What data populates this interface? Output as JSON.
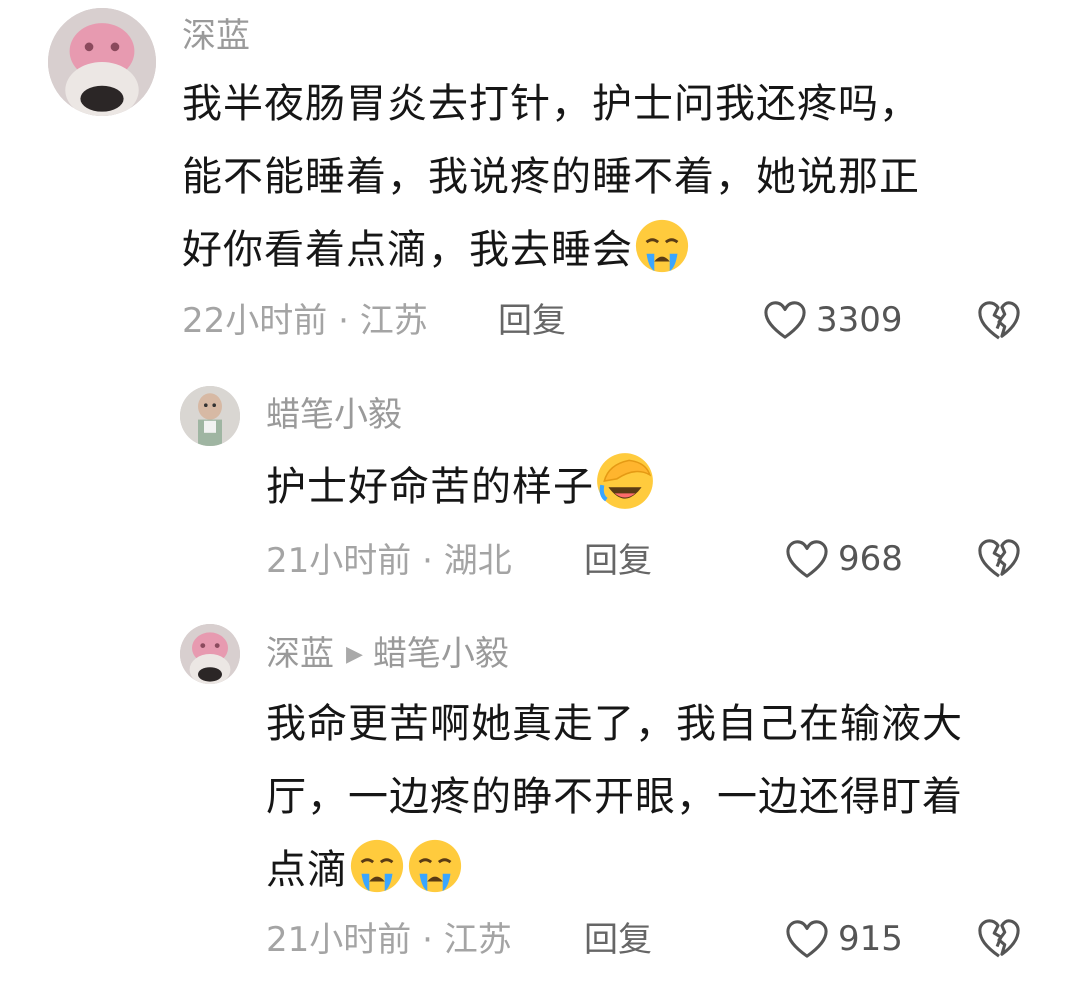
{
  "comments": [
    {
      "username": "深蓝",
      "text": "我半夜肠胃炎去打针，护士问我还疼吗，能不能睡着，我说疼的睡不着，她说那正好你看着点滴，我去睡会",
      "lines": [
        "我半夜肠胃炎去打针，护士问我还疼吗，",
        "能不能睡着，我说疼的睡不着，她说那正",
        "好你看着点滴，我去睡会"
      ],
      "emojis": [
        "crying-face"
      ],
      "time": "22小时前",
      "location": "江苏",
      "reply_label": "回复",
      "likes": "3309"
    },
    {
      "username": "蜡笔小毅",
      "text": "护士好命苦的样子",
      "lines": [
        "护士好命苦的样子"
      ],
      "emojis": [
        "facepalm-laughing-face"
      ],
      "time": "21小时前",
      "location": "湖北",
      "reply_label": "回复",
      "likes": "968"
    },
    {
      "username": "深蓝",
      "reply_to": "蜡笔小毅",
      "text": "我命更苦啊她真走了，我自己在输液大厅，一边疼的睁不开眼，一边还得盯着点滴",
      "lines": [
        "我命更苦啊她真走了，我自己在输液大",
        "厅，一边疼的睁不开眼，一边还得盯着",
        "点滴"
      ],
      "emojis": [
        "crying-face",
        "crying-face"
      ],
      "time": "21小时前",
      "location": "江苏",
      "reply_label": "回复",
      "likes": "915"
    }
  ],
  "meta_separator": " · ",
  "colors": {
    "username": "#9a9a9a",
    "text": "#161616",
    "meta": "#a4a4a4",
    "icon": "#555555"
  }
}
